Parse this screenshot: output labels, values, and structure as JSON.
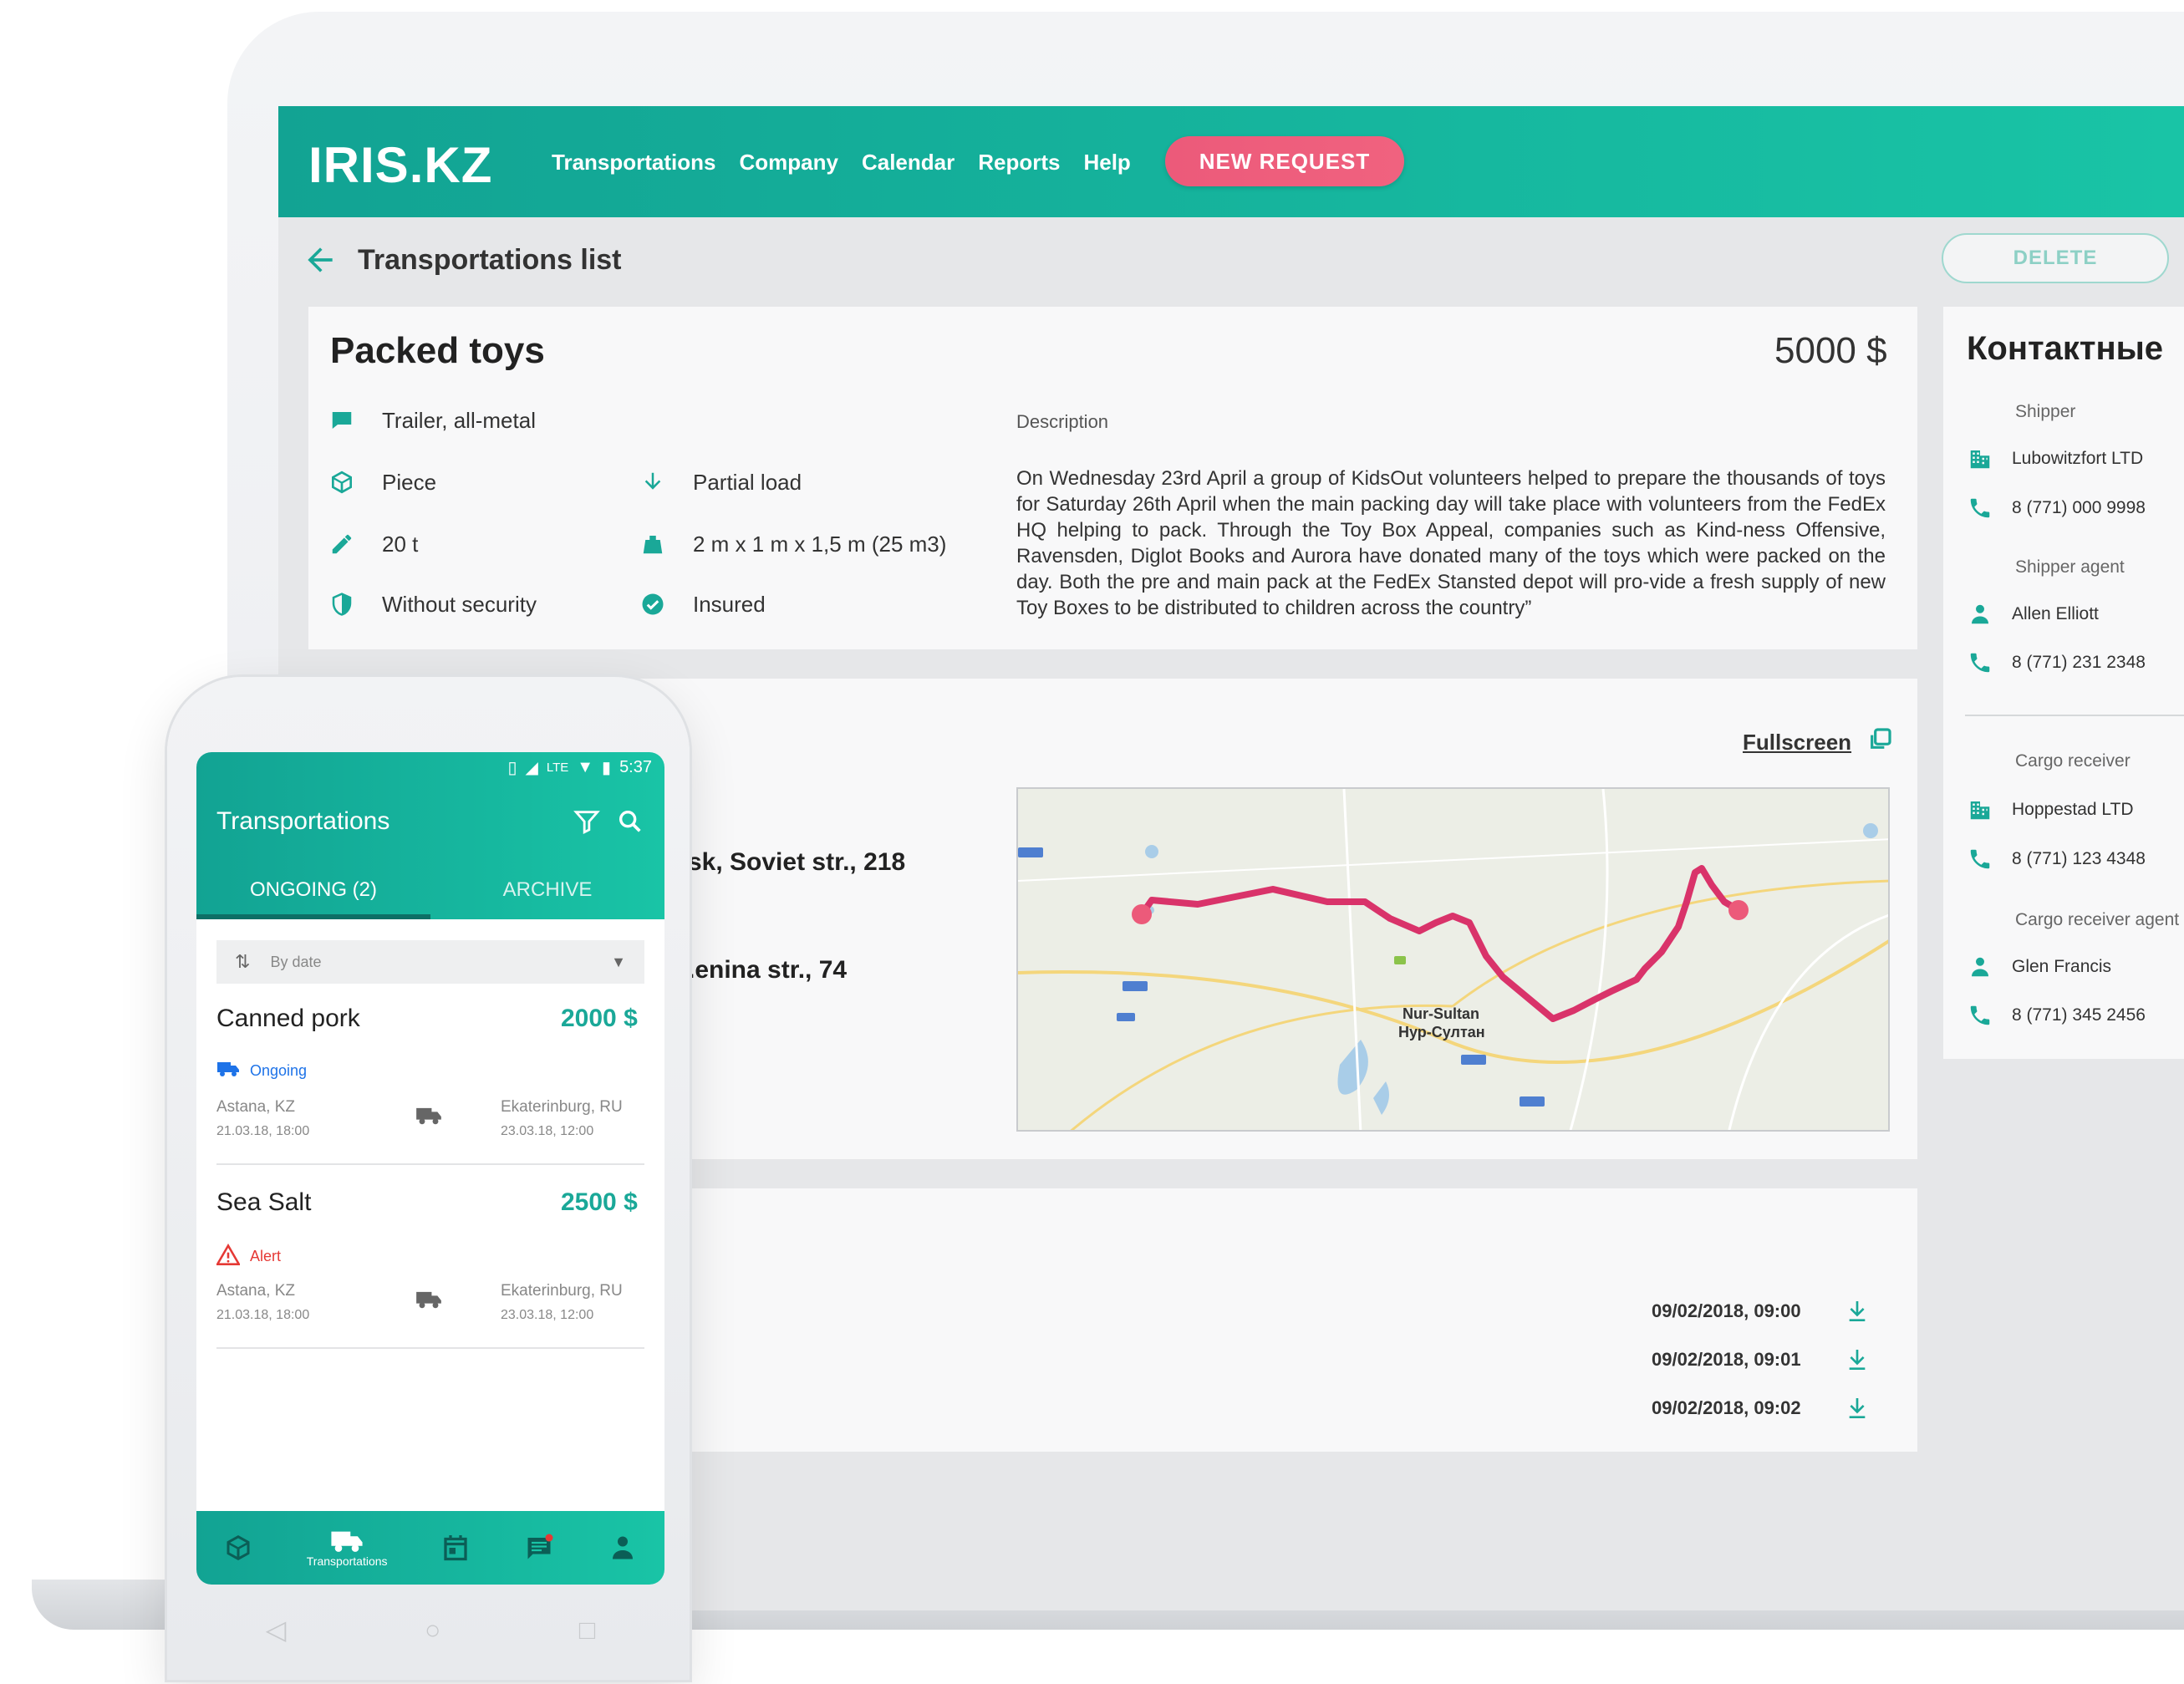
{
  "app": {
    "logo": "IRIS.KZ",
    "nav": [
      "Transportations",
      "Company",
      "Calendar",
      "Reports",
      "Help"
    ],
    "new_request": "NEW REQUEST",
    "page_title": "Transportations list",
    "delete": "DELETE"
  },
  "cargo": {
    "title": "Packed toys",
    "price": "5000 $",
    "props": {
      "trailer": "Trailer, all-metal",
      "unit": "Piece",
      "load": "Partial load",
      "weight": "20 t",
      "dims": "2 m x 1 m x 1,5 m (25 m3)",
      "security": "Without security",
      "insurance": "Insured"
    },
    "description_label": "Description",
    "description": "On Wednesday 23rd April a group of KidsOut volunteers helped to prepare the thousands of toys for Saturday 26th April when the main packing day will take place with volunteers from the FedEx HQ helping to pack. Through the Toy Box Appeal, companies such as Kind-ness Offensive, Ravensden, Diglot Books and Aurora have donated many of the toys which were packed on the day. Both the pre and main pack at the FedEx Stansted depot will pro-vide a fresh supply of new Toy Boxes to be distributed to children across the country”"
  },
  "route": {
    "fullscreen": "Fullscreen",
    "from_address": "sk, Soviet str., 218",
    "to_address": ".enina str., 74",
    "map_city": "Nur-Sultan",
    "map_city_alt": "Нур-Султан"
  },
  "documents": [
    {
      "date": "09/02/2018, 09:00"
    },
    {
      "date": "09/02/2018, 09:01"
    },
    {
      "date": "09/02/2018, 09:02"
    }
  ],
  "contacts": {
    "title": "Контактные",
    "shipper_label": "Shipper",
    "shipper_company": "Lubowitzfort LTD",
    "shipper_phone": "8 (771) 000 9998",
    "shipper_agent_label": "Shipper agent",
    "shipper_agent_name": "Allen Elliott",
    "shipper_agent_phone": "8 (771) 231 2348",
    "receiver_label": "Cargo receiver",
    "receiver_company": "Hoppestad LTD",
    "receiver_phone": "8 (771) 123 4348",
    "receiver_agent_label": "Cargo receiver agent",
    "receiver_agent_name": "Glen Francis",
    "receiver_agent_phone": "8 (771) 345 2456"
  },
  "phone": {
    "time": "5:37",
    "network": "LTE",
    "title": "Transportations",
    "tab_ongoing": "ONGOING (2)",
    "tab_archive": "ARCHIVE",
    "sort": "By date",
    "items": [
      {
        "title": "Canned pork",
        "price": "2000 $",
        "status": "Ongoing",
        "from": "Astana, KZ",
        "from_date": "21.03.18, 18:00",
        "to": "Ekaterinburg, RU",
        "to_date": "23.03.18, 12:00"
      },
      {
        "title": "Sea Salt",
        "price": "2500 $",
        "status": "Alert",
        "from": "Astana, KZ",
        "from_date": "21.03.18, 18:00",
        "to": "Ekaterinburg, RU",
        "to_date": "23.03.18, 12:00"
      }
    ],
    "bottom_active_label": "Transportations"
  },
  "colors": {
    "accent": "#1aa898",
    "brand_pink": "#ec5a7a",
    "route": "#d9336a",
    "alert": "#e53935",
    "ongoing": "#1e73e8"
  }
}
